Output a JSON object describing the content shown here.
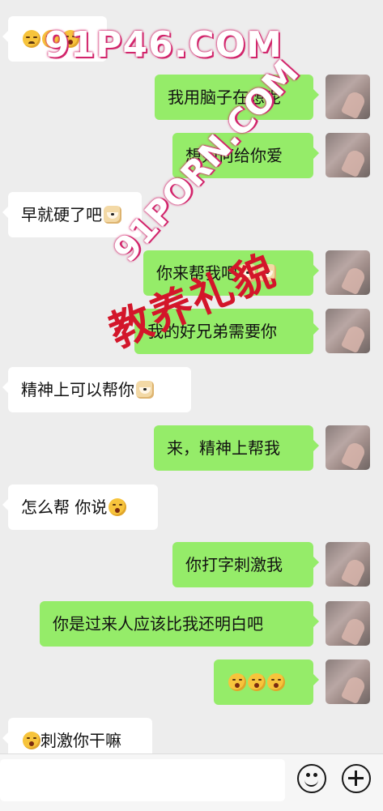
{
  "messages": [
    {
      "side": "in",
      "text": "",
      "emojis": [
        "face-sad",
        "face-kiss",
        "face-kiss"
      ]
    },
    {
      "side": "out",
      "text": "我用脑子在想呢",
      "emojis": []
    },
    {
      "side": "out",
      "text": "想如何给你爱",
      "emojis": []
    },
    {
      "side": "in",
      "text": "早就硬了吧",
      "emojis": [
        "face-dog"
      ]
    },
    {
      "side": "out",
      "text": "你来帮我吧",
      "emojis": [
        "face-dog",
        "face-dog"
      ]
    },
    {
      "side": "out",
      "text": "我的好兄弟需要你",
      "emojis": []
    },
    {
      "side": "in",
      "text": "精神上可以帮你",
      "emojis": [
        "face-dog"
      ]
    },
    {
      "side": "out",
      "text": "来，精神上帮我",
      "emojis": []
    },
    {
      "side": "in",
      "text": "怎么帮 你说",
      "emojis": [
        "face-kiss"
      ]
    },
    {
      "side": "out",
      "text": "你打字刺激我",
      "emojis": []
    },
    {
      "side": "out",
      "text": "你是过来人应该比我还明白吧",
      "emojis": []
    },
    {
      "side": "out",
      "text": "",
      "emojis": [
        "face-kiss",
        "face-kiss",
        "face-kiss"
      ]
    },
    {
      "side": "in",
      "text": "刺激你干嘛",
      "emojis": [
        "face-kiss"
      ],
      "emoji_first": true
    }
  ],
  "watermarks": {
    "site_a": "91P46.COM",
    "site_b": "91PORN.COM",
    "stamp": "教养礼貌"
  },
  "input": {
    "value": ""
  },
  "icons": {
    "emoji_button": "smiley-icon",
    "more_button": "plus-icon"
  },
  "colors": {
    "background": "#ededed",
    "bubble_out": "#95ec69",
    "bubble_in": "#ffffff",
    "watermark": "#d2266c",
    "stamp": "#d3162a"
  }
}
